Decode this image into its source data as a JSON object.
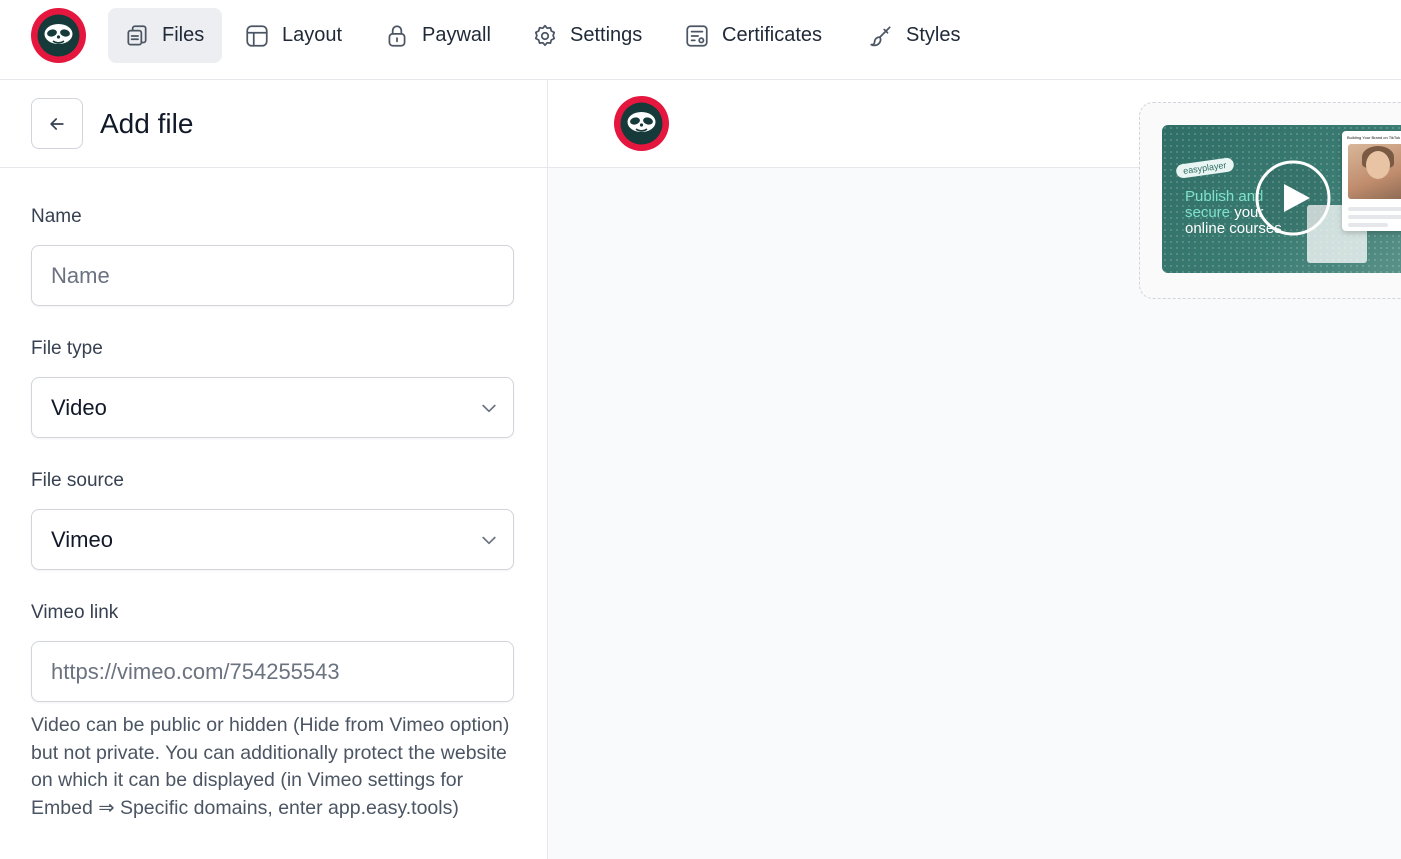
{
  "nav": {
    "items": [
      {
        "label": "Files",
        "icon": "files-icon",
        "active": true
      },
      {
        "label": "Layout",
        "icon": "layout-icon",
        "active": false
      },
      {
        "label": "Paywall",
        "icon": "lock-icon",
        "active": false
      },
      {
        "label": "Settings",
        "icon": "gear-icon",
        "active": false
      },
      {
        "label": "Certificates",
        "icon": "certificate-icon",
        "active": false
      },
      {
        "label": "Styles",
        "icon": "brush-icon",
        "active": false
      }
    ]
  },
  "form": {
    "title": "Add file",
    "name_label": "Name",
    "name_placeholder": "Name",
    "file_type_label": "File type",
    "file_type_value": "Video",
    "file_source_label": "File source",
    "file_source_value": "Vimeo",
    "vimeo_link_label": "Vimeo link",
    "vimeo_link_placeholder": "https://vimeo.com/754255543",
    "help_text": "Video can be public or hidden (Hide from Vimeo option) but not private. You can additionally protect the website on which it can be displayed (in Vimeo settings for Embed ⇒ Specific domains, enter app.easy.tools)"
  },
  "preview": {
    "badge": "easyplayer",
    "line1": "Publish and",
    "line2_highlight": "secure",
    "line2_rest": " your",
    "line3": "online courses",
    "card_heading": "Building Your Brand on TikTok"
  },
  "colors": {
    "brand_red": "#e5173f",
    "brand_dark": "#163a3a",
    "active_nav_bg": "#eceef1",
    "thumb_green": "#2f6e66"
  }
}
